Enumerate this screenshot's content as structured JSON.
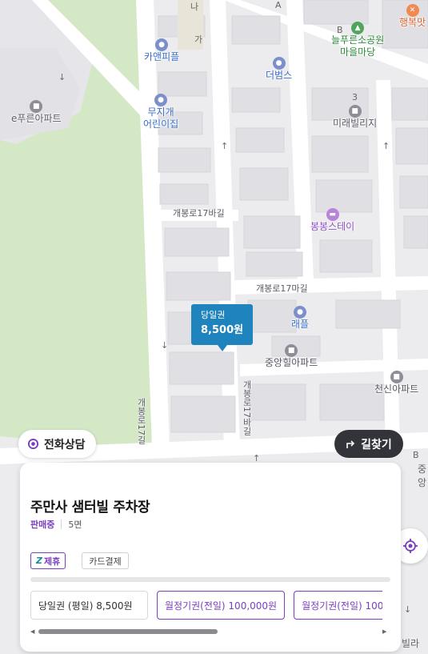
{
  "map": {
    "pois": [
      {
        "name": "카앤피플",
        "color": "blue"
      },
      {
        "name": "e푸른아파트",
        "color": "gray"
      },
      {
        "name": "무지개 어린이집",
        "color": "blue"
      },
      {
        "name": "더범스",
        "color": "blue"
      },
      {
        "name": "늘푸른소공원 마을마당",
        "color": "green"
      },
      {
        "name": "행복맛",
        "color": "orange"
      },
      {
        "name": "미래빌리지",
        "color": "gray"
      },
      {
        "name": "봉봉스테이",
        "color": "purple"
      },
      {
        "name": "래플",
        "color": "blue"
      },
      {
        "name": "중앙힐아파트",
        "color": "gray"
      },
      {
        "name": "천신아파트",
        "color": "gray"
      }
    ],
    "poi_labels": {
      "carpeople": "카앤피플",
      "epureun": "e푸른아파트",
      "mujigae_1": "무지개",
      "mujigae_2": "어린이집",
      "deobeomseu": "더범스",
      "park_1": "늘푸른소공원",
      "park_2": "마을마당",
      "haengbok": "행복맛",
      "mirae": "미래빌리지",
      "bongbong": "봉봉스테이",
      "raepeul": "래플",
      "jungang": "중앙힐아파트",
      "cheonsin": "천신아파트"
    },
    "road_labels": {
      "r1": "개봉로17바길",
      "r2": "개봉로17마길",
      "r3": "개봉로17바길",
      "r4": "개봉로17길"
    },
    "small_labels": {
      "na": "나",
      "ga": "가",
      "a": "A",
      "b1": "B",
      "n3": "3",
      "b2": "B",
      "jung": "중앙",
      "bottom": "빌라"
    },
    "price_marker": {
      "ticket_type": "당일권",
      "price": "8,500원"
    }
  },
  "buttons": {
    "consult": "전화상담",
    "route": "길찾기"
  },
  "lot": {
    "name": "주만사 샘터빌 주차장",
    "status": "판매중",
    "spaces": "5면",
    "tags": {
      "partner": "제휴",
      "card": "카드결제"
    },
    "tickets": [
      {
        "label": "당일권 (평일) 8,500원",
        "kind": "day"
      },
      {
        "label": "월정기권(전일) 100,000원",
        "kind": "month"
      },
      {
        "label": "월정기권(전일) 100",
        "kind": "month"
      }
    ]
  },
  "colors": {
    "accent_purple": "#7a3fbf",
    "marker_blue": "#1f84bd",
    "route_dark": "#33343a",
    "park_green": "#d7ebc9"
  },
  "scroll": {
    "position_fraction": 0.0,
    "visible_fraction": 0.52
  }
}
